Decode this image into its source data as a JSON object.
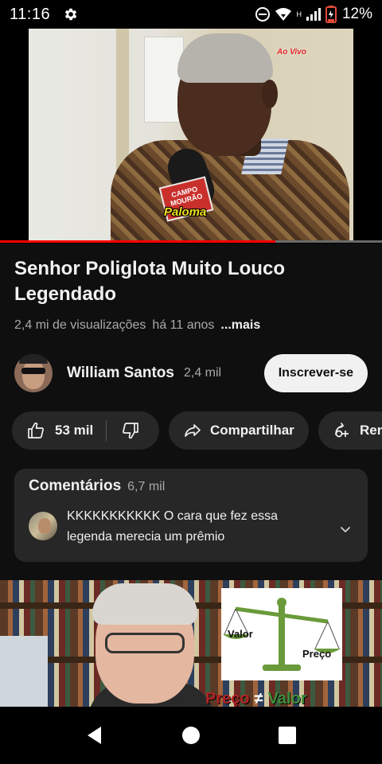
{
  "status_bar": {
    "time": "11:16",
    "battery_percent": "12%",
    "network_type": "H"
  },
  "video": {
    "live_tag": "Ao Vivo",
    "mic_flag_text": "CAMPO MOURÃO",
    "caption_name": "Paloma",
    "progress_fraction": 0.72
  },
  "title": "Senhor Poliglota Muito Louco Legendado",
  "meta": {
    "views": "2,4 mi de visualizações",
    "age": "há 11 anos",
    "more": "...mais"
  },
  "channel": {
    "name": "William Santos",
    "subscribers": "2,4 mil",
    "subscribe_label": "Inscrever-se"
  },
  "actions": {
    "like_count": "53 mil",
    "share_label": "Compartilhar",
    "remix_label": "Remix"
  },
  "comments": {
    "title": "Comentários",
    "count": "6,7 mil",
    "top_comment": "KKKKKKKKKKK O cara que fez essa legenda merecia um prêmio"
  },
  "next_video": {
    "logo_valor": "Valor",
    "logo_preco": "Preço",
    "banner_left": "Preço",
    "banner_symbol": "≠",
    "banner_right": "Valor"
  },
  "colors": {
    "background": "#0f0f0f",
    "chip": "#272727",
    "progress": "#ff0000",
    "secondary_text": "#aaaaaa"
  }
}
